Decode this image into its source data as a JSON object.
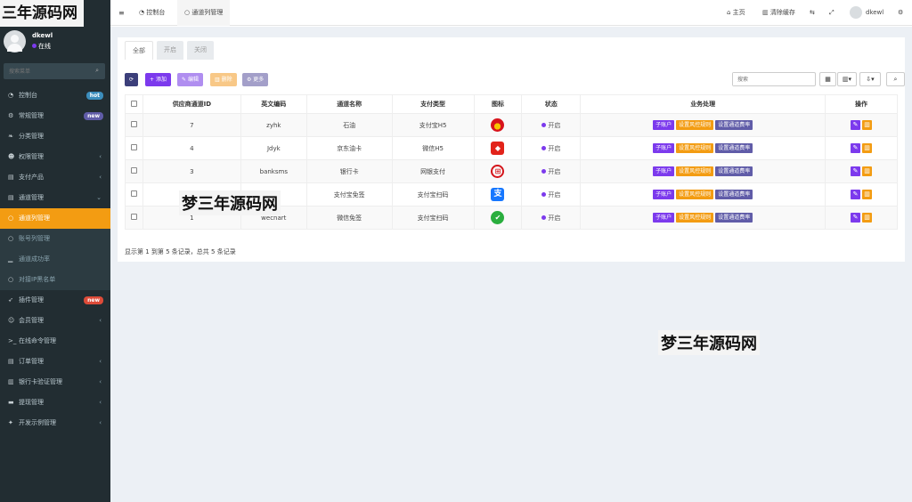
{
  "brand_watermark": "三年源码网",
  "user": {
    "name": "dkewl",
    "status": "在线"
  },
  "sidebar": {
    "search_placeholder": "搜索菜单",
    "items": [
      {
        "label": "控制台",
        "icon": "dashboard-icon",
        "badge": "hot",
        "badge_color": "#3c8dbc"
      },
      {
        "label": "常规管理",
        "icon": "cogs-icon",
        "badge": "new",
        "badge_color": "#605ca8"
      },
      {
        "label": "分类管理",
        "icon": "leaf-icon"
      },
      {
        "label": "权限管理",
        "icon": "users-icon",
        "arrow": "‹"
      },
      {
        "label": "支付产品",
        "icon": "list-icon",
        "arrow": "‹"
      },
      {
        "label": "通道管理",
        "icon": "list-icon",
        "arrow": "⌄"
      },
      {
        "label": "通道列管理",
        "icon": "circle-icon",
        "active": true
      },
      {
        "label": "账号列管理",
        "icon": "circle-icon",
        "sub": true
      },
      {
        "label": "通道成功率",
        "icon": "chart-icon",
        "sub": true
      },
      {
        "label": "对接IP黑名单",
        "icon": "circle-icon",
        "sub": true
      },
      {
        "label": "插件管理",
        "icon": "rocket-icon",
        "badge": "new",
        "badge_color": "#dd4b39"
      },
      {
        "label": "会员管理",
        "icon": "user-icon",
        "arrow": "‹"
      },
      {
        "label": "在线命令管理",
        "icon": "terminal-icon"
      },
      {
        "label": "订单管理",
        "icon": "list-icon",
        "arrow": "‹"
      },
      {
        "label": "银行卡验证管理",
        "icon": "bank-icon",
        "arrow": "‹"
      },
      {
        "label": "提现管理",
        "icon": "card-icon",
        "arrow": "‹"
      },
      {
        "label": "开发示例管理",
        "icon": "magic-icon",
        "arrow": "‹"
      }
    ]
  },
  "header": {
    "menu_icon": "≡",
    "tabs": [
      "控制台",
      "通道列管理"
    ],
    "right": {
      "home": "主页",
      "clear_cache": "清除缓存",
      "user": "dkewl"
    }
  },
  "main": {
    "filter_tabs": [
      "全部",
      "开启",
      "关闭"
    ],
    "toolbar": {
      "refresh": "⟳",
      "add": "添加",
      "edit": "编辑",
      "delete": "删除",
      "more": "更多"
    },
    "search_placeholder": "搜索",
    "columns": [
      "供应商通道ID",
      "英文编码",
      "通道名称",
      "支付类型",
      "图标",
      "状态",
      "业务处理",
      "操作"
    ],
    "rows": [
      {
        "id": "7",
        "code": "zyhk",
        "name": "石油",
        "pay_type": "支付宝H5",
        "icon": "petrochina-logo-icon",
        "status": "开启"
      },
      {
        "id": "4",
        "code": "Jdyk",
        "name": "京东油卡",
        "pay_type": "微信H5",
        "icon": "sinopec-logo-icon",
        "status": "开启"
      },
      {
        "id": "3",
        "code": "banksms",
        "name": "银行卡",
        "pay_type": "网银支付",
        "icon": "bank-logo-icon",
        "status": "开启"
      },
      {
        "id": "",
        "code": "",
        "name": "支付宝免签",
        "pay_type": "支付宝扫码",
        "icon": "alipay-logo-icon",
        "status": "开启"
      },
      {
        "id": "1",
        "code": "wecnart",
        "name": "微信免签",
        "pay_type": "支付宝扫码",
        "icon": "wechat-logo-icon",
        "status": "开启"
      }
    ],
    "actions": {
      "sub_account": "子账户",
      "risk_rule": "设置风控规则",
      "rate": "设置通道费率"
    },
    "footer": "显示第 1 到第 5 条记录，总共 5 条记录"
  },
  "watermarks": [
    "梦三年源码网",
    "梦三年源码网"
  ],
  "colors": {
    "sidebar": "#222d32",
    "active": "#f39c12",
    "purple": "#7c3aed",
    "orange": "#f39c12",
    "slate": "#605ca8"
  }
}
